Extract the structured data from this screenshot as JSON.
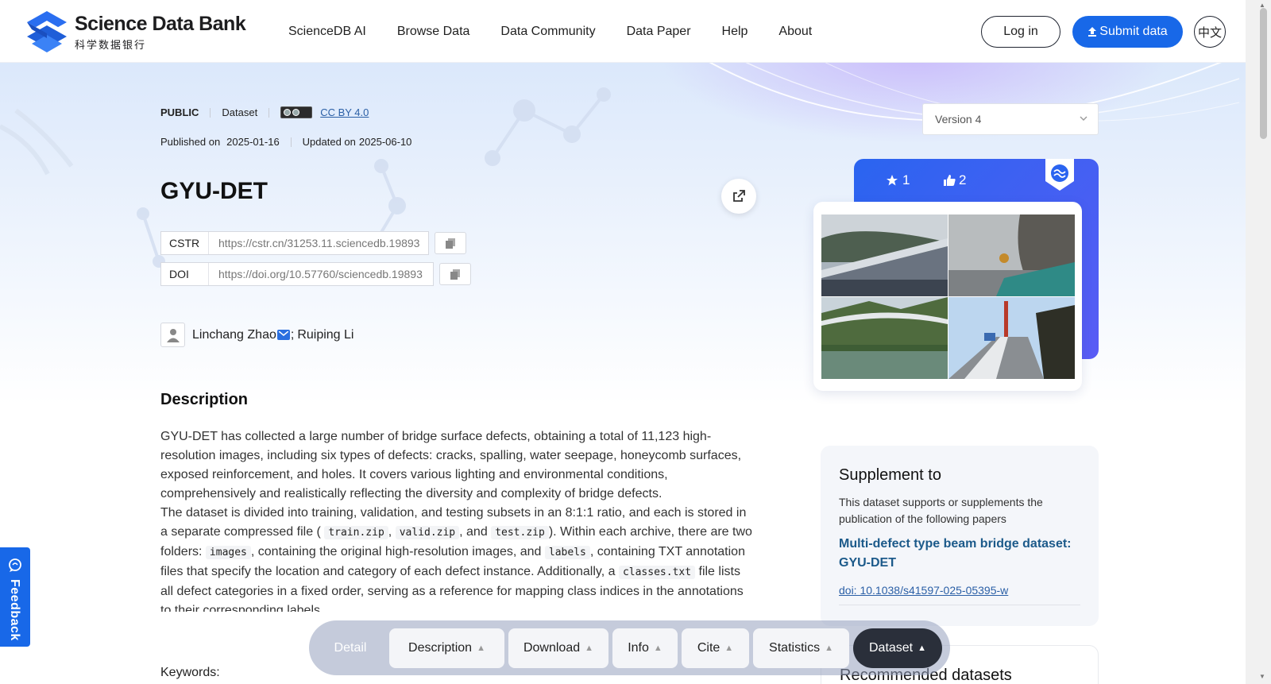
{
  "header": {
    "logo_title": "Science Data Bank",
    "logo_subtitle": "科学数据银行",
    "nav": [
      "ScienceDB AI",
      "Browse Data",
      "Data Community",
      "Data Paper",
      "Help",
      "About"
    ],
    "login_label": "Log in",
    "submit_label": "Submit data",
    "lang_label": "中文",
    "accent_color": "#1868e8"
  },
  "dataset": {
    "visibility": "PUBLIC",
    "type": "Dataset",
    "license": "CC BY 4.0",
    "published_label": "Published on",
    "published_date": "2025-01-16",
    "updated_label": "Updated on",
    "updated_date": "2025-06-10",
    "title": "GYU-DET",
    "cstr_label": "CSTR",
    "cstr_value": "https://cstr.cn/31253.11.sciencedb.19893",
    "doi_label": "DOI",
    "doi_value": "https://doi.org/10.57760/sciencedb.19893",
    "author1": "Linchang Zhao",
    "author_sep": ";",
    "author2": "Ruiping Li"
  },
  "description": {
    "heading": "Description",
    "p1": "GYU-DET has collected a large number of bridge surface defects, obtaining a total of 11,123 high-resolution images, including six types of defects: cracks, spalling, water seepage, honeycomb surfaces, exposed reinforcement, and holes. It covers various lighting and environmental conditions, comprehensively and realistically reflecting the diversity and complexity of bridge defects.",
    "p2_a": "The dataset is divided into training, validation, and testing subsets in an 8:1:1 ratio, and each is stored in a separate compressed file (",
    "code_train": "train.zip",
    "sep_comma": ",",
    "code_valid": "valid.zip",
    "p2_and": ", and",
    "code_test": "test.zip",
    "p2_b": "). Within each archive, there are two folders:",
    "code_images": "images",
    "p2_c": ", containing the original high-resolution images, and",
    "code_labels": "labels",
    "p2_d": ", containing TXT annotation files that specify the location and category of each defect instance. Additionally, a",
    "code_classes": "classes.txt",
    "p2_e": "file lists all defect categories in a fixed order, serving as a reference for mapping class indices in the annotations to their corresponding labels.",
    "keywords_label": "Keywords:"
  },
  "sidebar": {
    "version": "Version 4",
    "stars": "1",
    "likes": "2",
    "supplement_title": "Supplement to",
    "supplement_text": "This dataset supports or supplements the publication of the following papers",
    "paper_title": "Multi-defect type beam bridge dataset: GYU-DET",
    "paper_doi": "doi: 10.1038/s41597-025-05395-w",
    "recommended_title": "Recommended datasets"
  },
  "tabbar": {
    "detail": "Detail",
    "tabs": [
      "Description",
      "Download",
      "Info",
      "Cite",
      "Statistics"
    ],
    "active": "Dataset"
  },
  "feedback_label": "Feedback"
}
